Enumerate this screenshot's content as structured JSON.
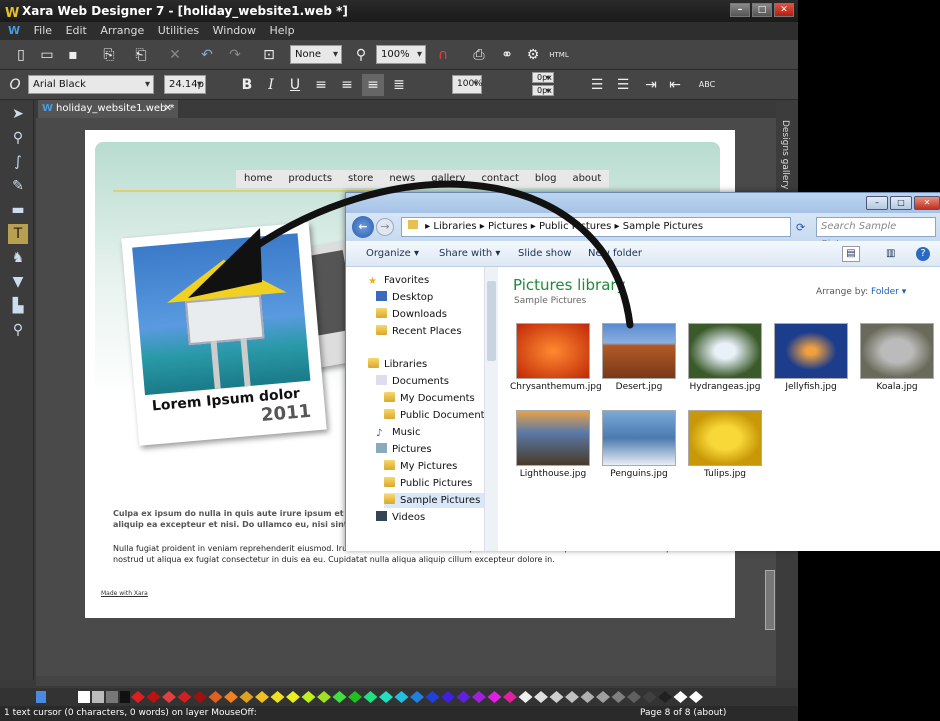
{
  "app": {
    "title": "Xara Web Designer 7 - [holiday_website1.web *]",
    "menu": [
      "File",
      "Edit",
      "Arrange",
      "Utilities",
      "Window",
      "Help"
    ],
    "toolbar": {
      "none_combo": "None",
      "zoom_combo": "100%",
      "html_label": "HTML"
    },
    "format": {
      "font": "Arial Black",
      "size": "24.14p",
      "bold": "B",
      "italic": "I",
      "underline": "U",
      "line_percent": "100%",
      "space_before": "0px",
      "space_after": "0px",
      "spell": "ABC"
    },
    "doc_tab": "holiday_website1.web *",
    "right_panel": "Designs gallery",
    "status": "1 text cursor (0 characters, 0 words) on layer MouseOff:",
    "page_indicator": "Page 8 of 8 (about)"
  },
  "website": {
    "nav": [
      "home",
      "products",
      "store",
      "news",
      "gallery",
      "contact",
      "blog",
      "about"
    ],
    "caption_title": "Lorem Ipsum dolor",
    "caption_year": "2011",
    "para1": "Culpa ex ipsum do nulla in quis aute irure ipsum et l aliquip ea excepteur et nisi. Do ullamco eu, nisi sint",
    "para2": "Nulla fugiat proident in veniam reprehenderit eiusmod. Irure Pariatur in minim veniam reprehenderit dolor ut aliqua. Pariatur occaecat in ipsum nostrud ut aliqua ex fugiat consectetur in duis ea eu. Cupidatat nulla aliqua aliquip cillum excepteur dolore in.",
    "made_with": "Made with Xara"
  },
  "explorer": {
    "path": [
      "Libraries",
      "Pictures",
      "Public Pictures",
      "Sample Pictures"
    ],
    "search_placeholder": "Search Sample Pictures",
    "commands": {
      "organize": "Organize ▾",
      "share": "Share with ▾",
      "slideshow": "Slide show",
      "newfolder": "New folder"
    },
    "nav": {
      "favorites": "Favorites",
      "desktop": "Desktop",
      "downloads": "Downloads",
      "recent": "Recent Places",
      "libraries": "Libraries",
      "documents": "Documents",
      "mydocs": "My Documents",
      "pubdocs": "Public Documents",
      "music": "Music",
      "pictures": "Pictures",
      "mypics": "My Pictures",
      "pubpics": "Public Pictures",
      "samplepics": "Sample Pictures",
      "videos": "Videos"
    },
    "library_title": "Pictures library",
    "library_sub": "Sample Pictures",
    "arrange_label": "Arrange by:",
    "arrange_value": "Folder ▾",
    "files": [
      {
        "name": "Chrysanthemum.jpg",
        "color": "#d8401a"
      },
      {
        "name": "Desert.jpg",
        "color": "#b25a28"
      },
      {
        "name": "Hydrangeas.jpg",
        "color": "#6a8a4a"
      },
      {
        "name": "Jellyfish.jpg",
        "color": "#1c3c8c"
      },
      {
        "name": "Koala.jpg",
        "color": "#8a8a7a"
      },
      {
        "name": "Lighthouse.jpg",
        "color": "#5a7aa8"
      },
      {
        "name": "Penguins.jpg",
        "color": "#4a7ab0"
      },
      {
        "name": "Tulips.jpg",
        "color": "#e8b818"
      }
    ]
  }
}
